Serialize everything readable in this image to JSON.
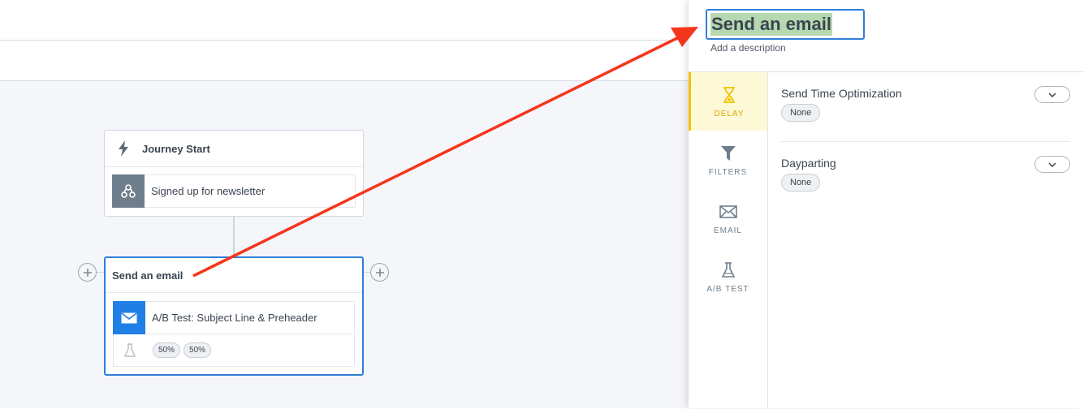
{
  "canvas": {
    "start_node": {
      "title": "Journey Start",
      "trigger_label": "Signed up for newsletter"
    },
    "email_node": {
      "title": "Send an email",
      "action_label": "A/B Test: Subject Line & Preheader",
      "variants": [
        "50%",
        "50%"
      ]
    }
  },
  "panel": {
    "title_value": "Send an email",
    "description_placeholder": "Add a description",
    "side_tabs": [
      {
        "label": "DELAY",
        "icon": "hourglass-icon",
        "active": true
      },
      {
        "label": "FILTERS",
        "icon": "filter-icon",
        "active": false
      },
      {
        "label": "EMAIL",
        "icon": "envelope-icon",
        "active": false
      },
      {
        "label": "A/B TEST",
        "icon": "flask-icon",
        "active": false
      }
    ],
    "settings": [
      {
        "label": "Send Time Optimization",
        "value": "None"
      },
      {
        "label": "Dayparting",
        "value": "None"
      }
    ]
  },
  "colors": {
    "accent_blue": "#2f7fd8",
    "delay_yellow": "#f2c200",
    "annotation_red": "#f5351b",
    "title_highlight": "#b6d8b0"
  }
}
